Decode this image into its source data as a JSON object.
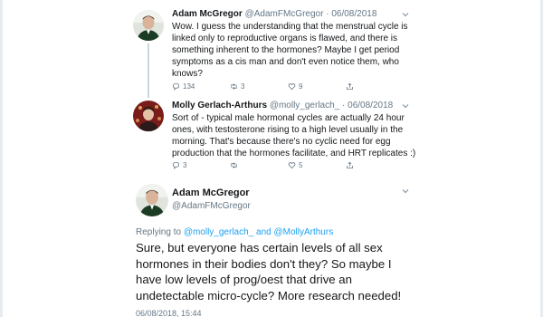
{
  "thread": [
    {
      "name": "Adam McGregor",
      "handle": "@AdamFMcGregor",
      "separator": "·",
      "date": "06/08/2018",
      "text": "Wow. I guess the understanding that the menstrual cycle is linked only to reproductive organs is flawed, and there is something inherent to the hormones? Maybe I get period symptoms as a cis man and don't even notice them, who knows?",
      "replies": "134",
      "retweets": "3",
      "likes": "9"
    },
    {
      "name": "Molly Gerlach-Arthurs",
      "handle": "@molly_gerlach_",
      "separator": "·",
      "date": "06/08/2018",
      "text": "Sort of - typical male hormonal cycles are actually 24 hour ones, with testosterone rising to a high level usually in the morning. That's because there's no cyclic need for egg production that the hormones facilitate, and HRT replicates :)",
      "replies": "3",
      "retweets": "",
      "likes": "5"
    }
  ],
  "focus": {
    "name": "Adam McGregor",
    "handle": "@AdamFMcGregor",
    "replying_prefix": "Replying to",
    "replying_user1": "@molly_gerlach_",
    "replying_and": "and",
    "replying_user2": "@MollyArthurs",
    "text": "Sure, but everyone has certain levels of all sex hormones in their bodies don't they? So maybe I have low levels of prog/oest that drive an undetectable micro-cycle? More research needed!",
    "timestamp": "06/08/2018, 15:44"
  },
  "icons": {
    "reply": "reply-icon",
    "retweet": "retweet-icon",
    "like": "heart-icon",
    "more": "chevron-down-icon"
  },
  "colors": {
    "accent": "#1da1f2",
    "muted": "#657786",
    "text": "#14171a",
    "line": "#ccd6dd"
  }
}
